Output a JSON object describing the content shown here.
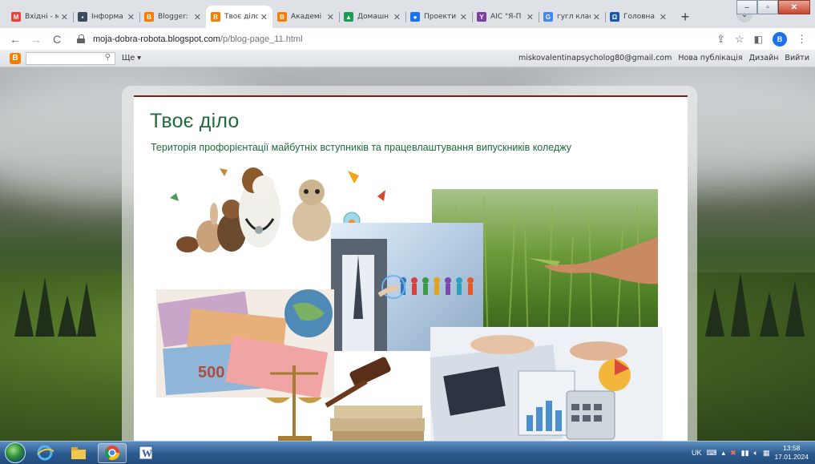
{
  "browser": {
    "tabs": [
      {
        "title": "Вхідні - м",
        "favicon": "gmail-icon",
        "color": "#ea4335",
        "glyph": "M",
        "active": false
      },
      {
        "title": "Інформа",
        "favicon": "image-icon",
        "color": "#3b4a5a",
        "glyph": "▪",
        "active": false
      },
      {
        "title": "Blogger:",
        "favicon": "blogger-icon",
        "color": "#f57d00",
        "glyph": "B",
        "active": false
      },
      {
        "title": "Твоє діло",
        "favicon": "blogger-icon",
        "color": "#f57d00",
        "glyph": "B",
        "active": true
      },
      {
        "title": "Академі",
        "favicon": "blogger-icon",
        "color": "#f57d00",
        "glyph": "B",
        "active": false
      },
      {
        "title": "Домашн",
        "favicon": "drive-icon",
        "color": "#1a9e55",
        "glyph": "▲",
        "active": false
      },
      {
        "title": "Проекти",
        "favicon": "google-sites-icon",
        "color": "#1a73e8",
        "glyph": "●",
        "active": false
      },
      {
        "title": "АІС \"Я-П",
        "favicon": "ais-icon",
        "color": "#7b3fa0",
        "glyph": "Y",
        "active": false
      },
      {
        "title": "гугл клас",
        "favicon": "google-icon",
        "color": "#4285f4",
        "glyph": "G",
        "active": false
      },
      {
        "title": "Головна",
        "favicon": "head-icon",
        "color": "#1a56b0",
        "glyph": "Ω",
        "active": false
      }
    ],
    "new_tab": "+",
    "tab_search": "⌄",
    "url_host": "moja-dobra-robota.blogspot.com",
    "url_path": "/p/blog-page_11.html",
    "profile_initial": "B"
  },
  "blogger_nav": {
    "search_value": "",
    "more_label": "Ще",
    "email": "miskovalentinapsycholog80@gmail.com",
    "new_post": "Нова публікація",
    "design": "Дизайн",
    "sign_out": "Вийти"
  },
  "blog": {
    "title": "Твоє діло",
    "description": "Територія профорієнтації майбутніх вступників та працевлаштування випускників коледжу",
    "collage_photos": [
      "animals",
      "wheat-field",
      "business-network",
      "money",
      "law-justice",
      "accounting"
    ]
  },
  "taskbar": {
    "language": "UK",
    "time": "13:58",
    "date": "17.01.2024",
    "apps": [
      "start-orb",
      "internet-explorer-icon",
      "file-explorer-icon",
      "chrome-icon",
      "word-icon"
    ]
  }
}
